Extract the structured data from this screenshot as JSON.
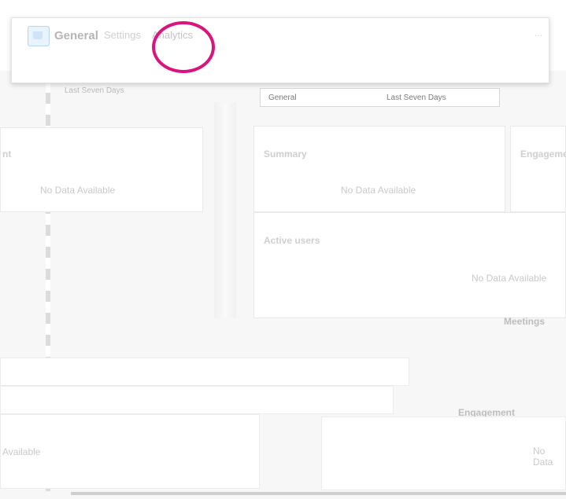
{
  "tabs": {
    "general": "General",
    "settings": "Settings",
    "analytics": "Analytics",
    "more": "..."
  },
  "toolbar": {
    "date_range": "Last Seven Days",
    "filter_general": "General",
    "filter_range": "Last Seven Days"
  },
  "cards": {
    "left_title": "nt",
    "left_empty": "No Data Available",
    "summary_title": "Summary",
    "summary_empty": "No Data Available",
    "engagement_top_title": "Engageme",
    "active_users_title": "Active users",
    "active_users_empty": "No Data Available",
    "meetings_title": "Meetings",
    "engagement_bottom_title": "Engagement",
    "bottom_right_empty": "No Data",
    "bottom_left_empty": "Available"
  },
  "colors": {
    "highlight": "#d9147e",
    "accent": "#e7e7fb"
  }
}
